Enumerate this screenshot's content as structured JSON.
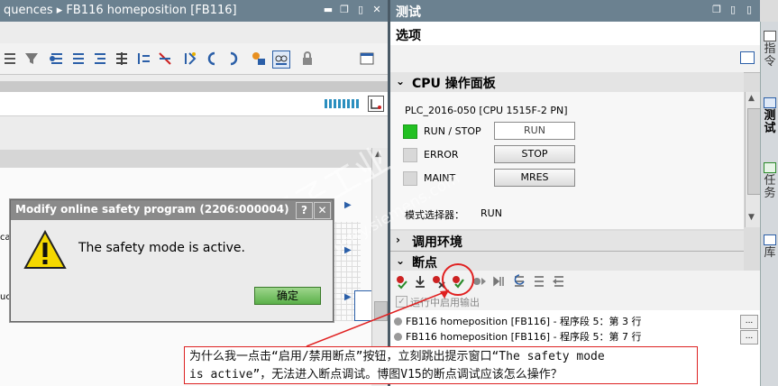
{
  "editor": {
    "title": "quences ▸ FB116 homeposition [FB116]",
    "ladder_cut_labels": [
      "ca",
      "uc"
    ]
  },
  "test_panel": {
    "title": "测试",
    "options_label": "选项",
    "cpu_panel": {
      "header": "CPU 操作面板",
      "plc_name": "PLC_2016-050 [CPU 1515F-2 PN]",
      "indicators": [
        {
          "label": "RUN / STOP",
          "color": "#22c022"
        },
        {
          "label": "ERROR",
          "color": "#d8d8d8"
        },
        {
          "label": "MAINT",
          "color": "#d8d8d8"
        }
      ],
      "buttons": [
        "RUN",
        "STOP",
        "MRES"
      ],
      "mode_selector_label": "模式选择器：",
      "mode_selector_value": "RUN"
    },
    "call_env_header": "调用环境",
    "breakpoints": {
      "header": "断点",
      "output_checkbox_label": "运行中启用输出",
      "items": [
        "FB116 homeposition [FB116] - 程序段 5：第 3 行",
        "FB116 homeposition [FB116] - 程序段 5：第 7 行"
      ],
      "more_label": "..."
    },
    "side_tabs": [
      "指令",
      "测试",
      "任务",
      "库"
    ]
  },
  "dialog": {
    "title": "Modify online safety program (2206:000004)",
    "help_label": "?",
    "close_label": "✕",
    "message": "The safety mode is active.",
    "ok_label": "确定"
  },
  "annotation": {
    "line1": "为什么我一点击“启用/禁用断点”按钮，立刻跳出提示窗口“The safety mode",
    "line2": "is active”，无法进入断点调试。博图V15的断点调试应该怎么操作？"
  },
  "watermark": {
    "line1": "西门子工业",
    "line2": "support.industry.siemens.com"
  },
  "colors": {
    "title_bar": "#6b8190",
    "run_led": "#22c022",
    "ok_button": "#5bb04a",
    "annotation_border": "#dd2222"
  }
}
